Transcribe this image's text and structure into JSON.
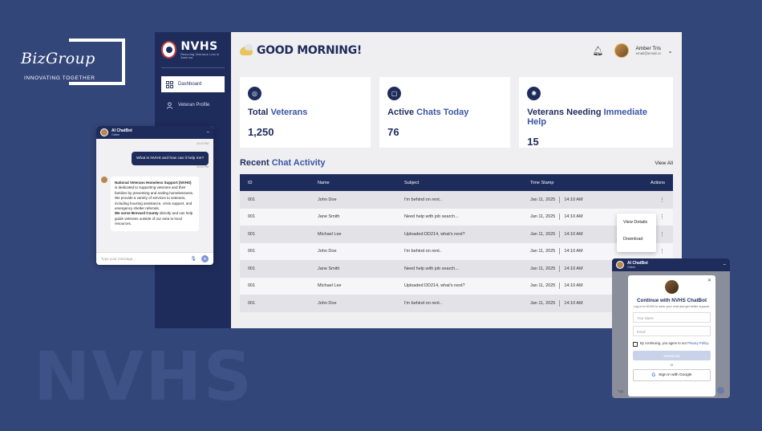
{
  "brand": {
    "name": "BizGroup",
    "tagline": "INNOVATING TOGETHER"
  },
  "watermark": "NVHS",
  "sidebar": {
    "logo_title": "NVHS",
    "logo_subtitle": "Rescuing Veterans Lost in America",
    "items": [
      {
        "label": "Dashboard",
        "icon": "grid-icon",
        "active": true
      },
      {
        "label": "Veteran Profile",
        "icon": "person-icon",
        "active": false
      }
    ]
  },
  "header": {
    "greeting": "GOOD MORNING!",
    "user_name": "Amber Tris",
    "user_email": "email@email.cc"
  },
  "stats": [
    {
      "title_plain": "Total ",
      "title_accent": "Veterans",
      "value": "1,250",
      "icon": "veterans-icon"
    },
    {
      "title_plain": "Active ",
      "title_accent": "Chats Today",
      "value": "76",
      "icon": "chat-icon"
    },
    {
      "title_plain": "Veterans Needing ",
      "title_accent": "Immediate Help",
      "value": "15",
      "icon": "alert-icon"
    }
  ],
  "activity": {
    "title_plain": "Recent ",
    "title_accent": "Chat Activity",
    "view_all": "View All",
    "columns": [
      "ID",
      "Name",
      "Subject",
      "Time Stamp",
      "Actions"
    ],
    "rows": [
      {
        "id": "001",
        "name": "John Doe",
        "subject": "I'm behind on rent..",
        "date": "Jan 11, 2025",
        "time": "14:10 AM"
      },
      {
        "id": "001",
        "name": "Jane Smith",
        "subject": "Need help with job search...",
        "date": "Jan 11, 2025",
        "time": "14:10 AM"
      },
      {
        "id": "001",
        "name": "Michael Lee",
        "subject": "Uploaded DD214, what's next?",
        "date": "Jan 11, 2025",
        "time": "14:10 AM"
      },
      {
        "id": "001",
        "name": "John Doe",
        "subject": "I'm behind on rent..",
        "date": "Jan 11, 2025",
        "time": "14:10 AM"
      },
      {
        "id": "001",
        "name": "Jane Smith",
        "subject": "Need help with job search...",
        "date": "Jan 11, 2025",
        "time": "14:10 AM"
      },
      {
        "id": "001",
        "name": "Michael Lee",
        "subject": "Uploaded DD214, what's next?",
        "date": "Jan 11, 2025",
        "time": "14:10 AM"
      },
      {
        "id": "001",
        "name": "John Doe",
        "subject": "I'm behind on rent..",
        "date": "Jan 11, 2025",
        "time": "14:10 AM"
      }
    ],
    "menu": [
      "View Details",
      "Download"
    ]
  },
  "chatbot": {
    "name": "AI ChatBot",
    "status": "Online",
    "ts1": "10:10 PM",
    "user_msg": "What is NVHS and how can it help me?",
    "ts2": "10:10 PM",
    "bot_bold": "National Veterans Homeless Support (NVHS)",
    "bot_text": " is dedicated to supporting veterans and their families by preventing and ending homelessness. We provide a variety of services to veterans, including housing assistance, crisis support, and emergency shelter referrals.",
    "bot_bold2": "We serve Brevard County",
    "bot_text2": " directly and can help guide veterans outside of our area to local resources.",
    "placeholder": "Type your message..."
  },
  "login_modal": {
    "title": "Continue with NVHS ChatBot",
    "subtitle": "Log in to NVHS to save your chat and get better support.",
    "name_placeholder": "Your Name",
    "email_placeholder": "Email",
    "agree_text": "By continuing, you agree to our ",
    "agree_link": "Privacy Policy.",
    "download_label": "Download",
    "or_label": "or",
    "google_label": "Sign in with Google"
  }
}
